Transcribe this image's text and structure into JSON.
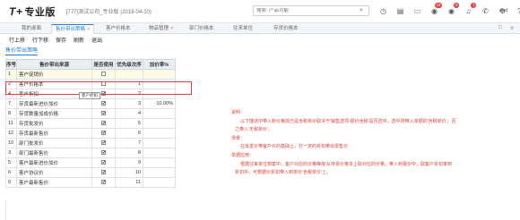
{
  "app": {
    "logo": "T+",
    "edition": "专业版",
    "account": "[777]测试公司_专业版 (2018-04-10)",
    "search_placeholder": "搜索: 产品功能",
    "user": "ded",
    "notification_counts": [
      "23",
      "6",
      "1"
    ]
  },
  "tabs": {
    "items": [
      "我的桌面",
      "售价带出策略",
      "客户价格本",
      "物品管理",
      "部门价格本",
      "往来单位",
      "存货价格本"
    ],
    "close": "×",
    "right_icons": [
      "□",
      "⋎"
    ]
  },
  "toolbar": {
    "items": [
      "行上移",
      "行下移",
      "保存",
      "刷新",
      "退出"
    ]
  },
  "subtitle": "售价带出策略",
  "grid": {
    "headers": [
      "序号",
      "售价带出来源",
      "是否使用",
      "优先级次序",
      "加价率%"
    ],
    "rows": [
      {
        "seq": "1",
        "name": "客户促销价",
        "used": "",
        "prio": "",
        "rate": ""
      },
      {
        "seq": "2",
        "name": "客户价格本",
        "used": "",
        "prio": "1",
        "rate": ""
      },
      {
        "seq": "4",
        "name": "客户折扣",
        "used": "✔",
        "prio": "2",
        "rate": ""
      },
      {
        "seq": "7",
        "name": "存货最新进价加价",
        "used": "✔",
        "prio": "3",
        "rate": "10.00%"
      },
      {
        "seq": "8",
        "name": "存货数量加成价格",
        "used": "✔",
        "prio": "4",
        "rate": ""
      },
      {
        "seq": "11",
        "name": "存货批发价",
        "used": "✔",
        "prio": "5",
        "rate": ""
      },
      {
        "seq": "12",
        "name": "存货最新售价",
        "used": "✔",
        "prio": "6",
        "rate": ""
      },
      {
        "seq": "10",
        "name": "部门批发价",
        "used": "✔",
        "prio": "7",
        "rate": ""
      },
      {
        "seq": "3",
        "name": "部门最新售价",
        "used": "✔",
        "prio": "8",
        "rate": ""
      },
      {
        "seq": "5",
        "name": "客户最新进价加价",
        "used": "✔",
        "prio": "9",
        "rate": ""
      },
      {
        "seq": "6",
        "name": "客户协议价",
        "used": "✔",
        "prio": "10",
        "rate": ""
      },
      {
        "seq": "9",
        "name": "客户最新售价",
        "used": "✔",
        "prio": "11",
        "rate": ""
      }
    ]
  },
  "tooltip": "客户折扣",
  "explanation": {
    "l1": "说明：",
    "l2": "以下描述中带入新价格前已是含税单价取决于'销售选项-报价含税'是否选中，选中则带入单据的'含税单价'，否",
    "l3": "之带入'无税单价'。",
    "l4": "场景：",
    "l5": "在批发价带客户价的基础上，打一定的折扣带出零售价",
    "l6": "单据应用：",
    "l7": "根据往来单位档案中，客户对应的价格等级'从存货价格本上取对应的价格，带入到报价中；取客户折扣率到",
    "l8": "折扣中，可根据价折扣带入到单价'含税单价'上。"
  },
  "colors": {
    "accent": "#2a7fd4",
    "highlight": "#e23b3b",
    "note": "#d9443b"
  }
}
